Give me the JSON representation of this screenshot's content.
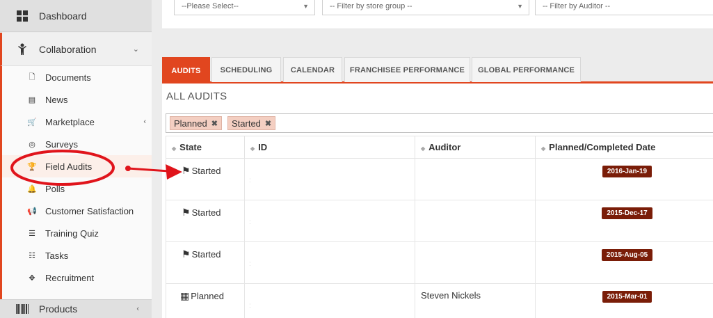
{
  "sidebar": {
    "dashboard": {
      "label": "Dashboard",
      "icon": "dashboard-icon"
    },
    "collaboration": {
      "label": "Collaboration",
      "icon": "person-icon"
    },
    "items": [
      {
        "label": "Documents",
        "icon": "document-icon",
        "glyph": "🗋"
      },
      {
        "label": "News",
        "icon": "newspaper-icon",
        "glyph": "▤"
      },
      {
        "label": "Marketplace",
        "icon": "cart-icon",
        "glyph": "🛒"
      },
      {
        "label": "Surveys",
        "icon": "target-icon",
        "glyph": "◎"
      },
      {
        "label": "Field Audits",
        "icon": "trophy-icon",
        "glyph": "🏆"
      },
      {
        "label": "Polls",
        "icon": "bell-icon",
        "glyph": "🔔"
      },
      {
        "label": "Customer Satisfaction",
        "icon": "megaphone-icon",
        "glyph": "📢"
      },
      {
        "label": "Training Quiz",
        "icon": "list-icon",
        "glyph": "☰"
      },
      {
        "label": "Tasks",
        "icon": "tasks-icon",
        "glyph": "☷"
      },
      {
        "label": "Recruitment",
        "icon": "crosshair-icon",
        "glyph": "✥"
      }
    ],
    "products": {
      "label": "Products",
      "icon": "barcode-icon"
    }
  },
  "filters": [
    {
      "placeholder": "--Please Select--"
    },
    {
      "placeholder": "-- Filter by store group --"
    },
    {
      "placeholder": "-- Filter by Auditor --"
    }
  ],
  "tabs": [
    "AUDITS",
    "SCHEDULING",
    "CALENDAR",
    "FRANCHISEE PERFORMANCE",
    "GLOBAL PERFORMANCE"
  ],
  "active_tab": "AUDITS",
  "section_title": "ALL AUDITS",
  "tags": [
    {
      "label": "Planned"
    },
    {
      "label": "Started"
    }
  ],
  "table": {
    "columns": [
      "State",
      "ID",
      "Auditor",
      "Planned/Completed Date"
    ],
    "rows": [
      {
        "state": "Started",
        "state_icon": "flag-icon",
        "auditor": "",
        "date": "2016-Jan-19"
      },
      {
        "state": "Started",
        "state_icon": "flag-icon",
        "auditor": "",
        "date": "2015-Dec-17"
      },
      {
        "state": "Started",
        "state_icon": "flag-icon",
        "auditor": "",
        "date": "2015-Aug-05"
      },
      {
        "state": "Planned",
        "state_icon": "calendar-icon",
        "auditor": "Steven Nickels",
        "date": "2015-Mar-01"
      }
    ]
  },
  "colors": {
    "accent": "#e1461f",
    "date_badge": "#7a1d08",
    "annotation": "#e0141b",
    "tag_bg": "#f4cfc2"
  }
}
